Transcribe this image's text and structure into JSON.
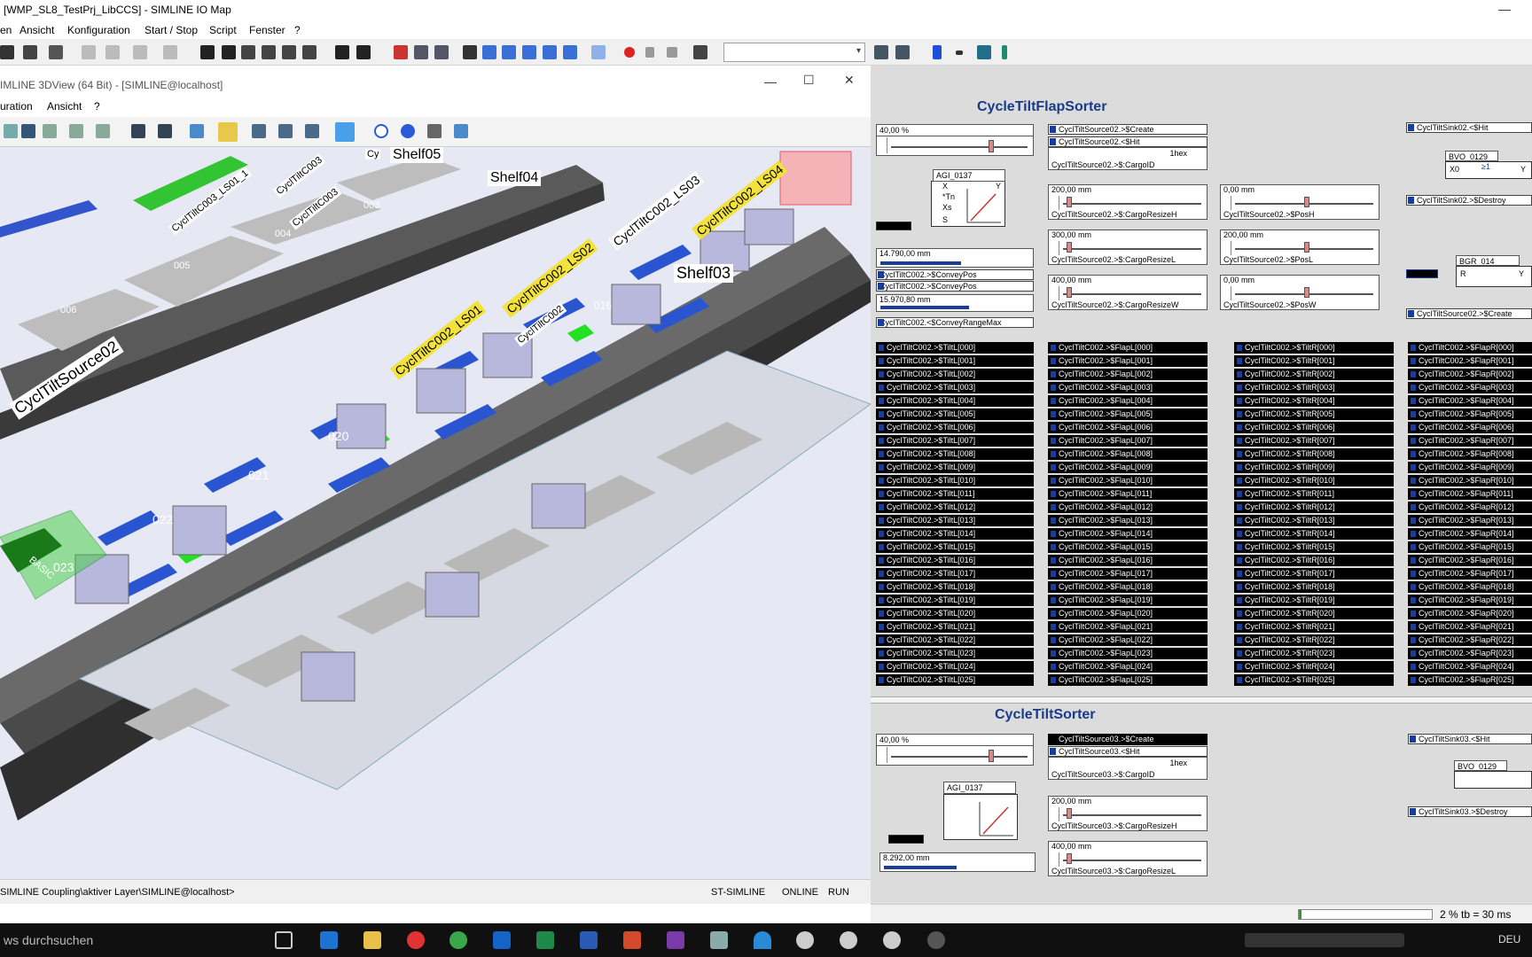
{
  "app": {
    "title": "[WMP_SL8_TestPrj_LibCCS] - SIMLINE IO Map",
    "menu": [
      "en",
      "Ansicht",
      "Konfiguration",
      "Start / Stop",
      "Script",
      "Fenster",
      "?"
    ]
  },
  "view3d": {
    "title": "IMLINE 3DView (64 Bit) - [SIMLINE@localhost]",
    "menu": [
      "uration",
      "Ansicht",
      "?"
    ],
    "labels": {
      "shelf05": "Shelf05",
      "shelf04": "Shelf04",
      "shelf03": "Shelf03",
      "source": "CyclTiltSource02",
      "ls01": "CyclTiltC002_LS01",
      "ls02": "CyclTiltC002_LS02",
      "ls03": "CyclTiltC002_LS03",
      "ls04": "CyclTiltC002_LS04",
      "c003_ls01": "CyclTiltC003_LS01_1",
      "c003a": "CyclTiltC003",
      "c003b": "CyclTiltC003",
      "c002": "CyclTiltC002",
      "cy": "Cy",
      "basic": "BASIC",
      "n006": "006",
      "n005": "005",
      "n004": "004",
      "n003": "003",
      "n016": "016",
      "n020": "020",
      "n021": "021",
      "n022": "022",
      "n023": "023"
    },
    "status": {
      "path": "SIMLINE Coupling\\aktiver Layer\\SIMLINE@localhost>",
      "mode": "ST-SIMLINE",
      "online": "ONLINE",
      "run": "RUN"
    }
  },
  "iomap": {
    "flap": {
      "title": "CycleTiltFlapSorter",
      "speed": "40,00 %",
      "agi": "AGI_0137",
      "agi_pins": [
        "X",
        "*Tn",
        "Xs",
        "S",
        "Y"
      ],
      "create": "CyclTiltSource02.>$Create",
      "hit": "CyclTiltSource02.<$Hit",
      "hex": "1hex",
      "cargoid": "CyclTiltSource02.>$:CargoID",
      "v1": "200,00 mm",
      "l1": "CyclTiltSource02.>$:CargoResizeH",
      "v2": "300,00 mm",
      "l2": "CyclTiltSource02.>$:CargoResizeL",
      "v3": "400,00 mm",
      "l3": "CyclTiltSource02.>$:CargoResizeW",
      "p1": "0,00 mm",
      "pl1": "CyclTiltSource02.>$PosH",
      "p2": "200,00 mm",
      "pl2": "CyclTiltSource02.>$PosL",
      "p3": "0,00 mm",
      "pl3": "CyclTiltSource02.>$PosW",
      "conv1": "14.790,00 mm",
      "conv1_fill": 0.55,
      "cp1": "CyclTiltC002.>$ConveyPos",
      "cp2": "CyclTiltC002.>$ConveyPos",
      "conv2": "15.970,80 mm",
      "conv2_fill": 0.6,
      "cmax": "CyclTiltC002.<$ConveyRangeMax",
      "sink_hit": "CyclTiltSink02.<$Hit",
      "bvo": "BVO_0129",
      "bvo_pins": [
        "X0",
        "≥1",
        "Y"
      ],
      "sink_destroy": "CyclTiltSink02.>$Destroy",
      "bgr": "BGR_014",
      "bgr_pins": [
        "R",
        "Y"
      ],
      "sink_create": "CyclTiltSource02.>$Create",
      "tiltl": [
        "CyclTiltC002.>$TiltL[000]",
        "CyclTiltC002.>$TiltL[001]",
        "CyclTiltC002.>$TiltL[002]",
        "CyclTiltC002.>$TiltL[003]",
        "CyclTiltC002.>$TiltL[004]",
        "CyclTiltC002.>$TiltL[005]",
        "CyclTiltC002.>$TiltL[006]",
        "CyclTiltC002.>$TiltL[007]",
        "CyclTiltC002.>$TiltL[008]",
        "CyclTiltC002.>$TiltL[009]",
        "CyclTiltC002.>$TiltL[010]",
        "CyclTiltC002.>$TiltL[011]",
        "CyclTiltC002.>$TiltL[012]",
        "CyclTiltC002.>$TiltL[013]",
        "CyclTiltC002.>$TiltL[014]",
        "CyclTiltC002.>$TiltL[015]",
        "CyclTiltC002.>$TiltL[016]",
        "CyclTiltC002.>$TiltL[017]",
        "CyclTiltC002.>$TiltL[018]",
        "CyclTiltC002.>$TiltL[019]",
        "CyclTiltC002.>$TiltL[020]",
        "CyclTiltC002.>$TiltL[021]",
        "CyclTiltC002.>$TiltL[022]",
        "CyclTiltC002.>$TiltL[023]",
        "CyclTiltC002.>$TiltL[024]",
        "CyclTiltC002.>$TiltL[025]"
      ],
      "flapl": [
        "CyclTiltC002.>$FlapL[000]",
        "CyclTiltC002.>$FlapL[001]",
        "CyclTiltC002.>$FlapL[002]",
        "CyclTiltC002.>$FlapL[003]",
        "CyclTiltC002.>$FlapL[004]",
        "CyclTiltC002.>$FlapL[005]",
        "CyclTiltC002.>$FlapL[006]",
        "CyclTiltC002.>$FlapL[007]",
        "CyclTiltC002.>$FlapL[008]",
        "CyclTiltC002.>$FlapL[009]",
        "CyclTiltC002.>$FlapL[010]",
        "CyclTiltC002.>$FlapL[011]",
        "CyclTiltC002.>$FlapL[012]",
        "CyclTiltC002.>$FlapL[013]",
        "CyclTiltC002.>$FlapL[014]",
        "CyclTiltC002.>$FlapL[015]",
        "CyclTiltC002.>$FlapL[016]",
        "CyclTiltC002.>$FlapL[017]",
        "CyclTiltC002.>$FlapL[018]",
        "CyclTiltC002.>$FlapL[019]",
        "CyclTiltC002.>$FlapL[020]",
        "CyclTiltC002.>$FlapL[021]",
        "CyclTiltC002.>$FlapL[022]",
        "CyclTiltC002.>$FlapL[023]",
        "CyclTiltC002.>$FlapL[024]",
        "CyclTiltC002.>$FlapL[025]"
      ],
      "tiltr": [
        "CyclTiltC002.>$TiltR[000]",
        "CyclTiltC002.>$TiltR[001]",
        "CyclTiltC002.>$TiltR[002]",
        "CyclTiltC002.>$TiltR[003]",
        "CyclTiltC002.>$TiltR[004]",
        "CyclTiltC002.>$TiltR[005]",
        "CyclTiltC002.>$TiltR[006]",
        "CyclTiltC002.>$TiltR[007]",
        "CyclTiltC002.>$TiltR[008]",
        "CyclTiltC002.>$TiltR[009]",
        "CyclTiltC002.>$TiltR[010]",
        "CyclTiltC002.>$TiltR[011]",
        "CyclTiltC002.>$TiltR[012]",
        "CyclTiltC002.>$TiltR[013]",
        "CyclTiltC002.>$TiltR[014]",
        "CyclTiltC002.>$TiltR[015]",
        "CyclTiltC002.>$TiltR[016]",
        "CyclTiltC002.>$TiltR[017]",
        "CyclTiltC002.>$TiltR[018]",
        "CyclTiltC002.>$TiltR[019]",
        "CyclTiltC002.>$TiltR[020]",
        "CyclTiltC002.>$TiltR[021]",
        "CyclTiltC002.>$TiltR[022]",
        "CyclTiltC002.>$TiltR[023]",
        "CyclTiltC002.>$TiltR[024]",
        "CyclTiltC002.>$TiltR[025]"
      ],
      "flapr": [
        "CyclTiltC002.>$FlapR[000]",
        "CyclTiltC002.>$FlapR[001]",
        "CyclTiltC002.>$FlapR[002]",
        "CyclTiltC002.>$FlapR[003]",
        "CyclTiltC002.>$FlapR[004]",
        "CyclTiltC002.>$FlapR[005]",
        "CyclTiltC002.>$FlapR[006]",
        "CyclTiltC002.>$FlapR[007]",
        "CyclTiltC002.>$FlapR[008]",
        "CyclTiltC002.>$FlapR[009]",
        "CyclTiltC002.>$FlapR[010]",
        "CyclTiltC002.>$FlapR[011]",
        "CyclTiltC002.>$FlapR[012]",
        "CyclTiltC002.>$FlapR[013]",
        "CyclTiltC002.>$FlapR[014]",
        "CyclTiltC002.>$FlapR[015]",
        "CyclTiltC002.>$FlapR[016]",
        "CyclTiltC002.>$FlapR[017]",
        "CyclTiltC002.>$FlapR[018]",
        "CyclTiltC002.>$FlapR[019]",
        "CyclTiltC002.>$FlapR[020]",
        "CyclTiltC002.>$FlapR[021]",
        "CyclTiltC002.>$FlapR[022]",
        "CyclTiltC002.>$FlapR[023]",
        "CyclTiltC002.>$FlapR[024]",
        "CyclTiltC002.>$FlapR[025]"
      ]
    },
    "tilt": {
      "title": "CycleTiltSorter",
      "speed": "40,00 %",
      "agi": "AGI_0137",
      "create": "CyclTiltSource03.>$Create",
      "hit": "CyclTiltSource03.<$Hit",
      "hex": "1hex",
      "cargoid": "CyclTiltSource03.>$:CargoID",
      "v1": "200,00 mm",
      "l1": "CyclTiltSource03.>$:CargoResizeH",
      "v2": "400,00 mm",
      "l2": "CyclTiltSource03.>$:CargoResizeL",
      "conv1": "8.292,00 mm",
      "conv1_fill": 0.5,
      "sink_hit": "CyclTiltSink03.<$Hit",
      "bvo": "BVO_0129",
      "sink_destroy": "CyclTiltSink03.>$Destroy"
    },
    "status": "2 % tb = 30 ms",
    "status_fill": 0.02
  },
  "taskbar": {
    "search": "ws durchsuchen",
    "lang": "DEU"
  },
  "colors": {
    "title_blue": "#1a3a8a",
    "signal_bg": "#000000",
    "cargo_blue": "#2a55d0",
    "conveyor_dark": "#555555"
  }
}
